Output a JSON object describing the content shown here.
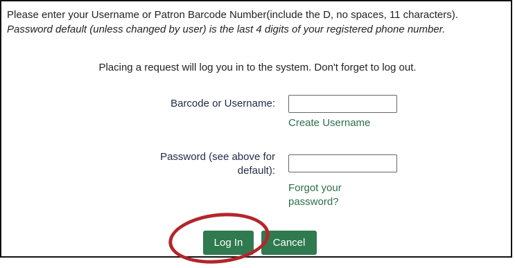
{
  "instructions": {
    "line1": "Please enter your Username or Patron Barcode Number(include the D, no spaces, 11 characters).",
    "line2": "Password default (unless changed by user) is the last 4 digits of your registered phone number."
  },
  "notice": "Placing a request will log you in to the system. Don't forget to log out.",
  "form": {
    "username_label": "Barcode or Username:",
    "username_value": "",
    "create_username_link": "Create Username",
    "password_label_line1": "Password (see above for",
    "password_label_line2": "default):",
    "password_value": "",
    "forgot_password_line1": "Forgot your",
    "forgot_password_line2": "password?"
  },
  "buttons": {
    "login": "Log In",
    "cancel": "Cancel"
  },
  "annotation": {
    "highlight_color": "#b3262b"
  },
  "colors": {
    "button_green": "#2f7a4f",
    "link_green": "#2e6e4c",
    "label_navy": "#1f2a44"
  }
}
